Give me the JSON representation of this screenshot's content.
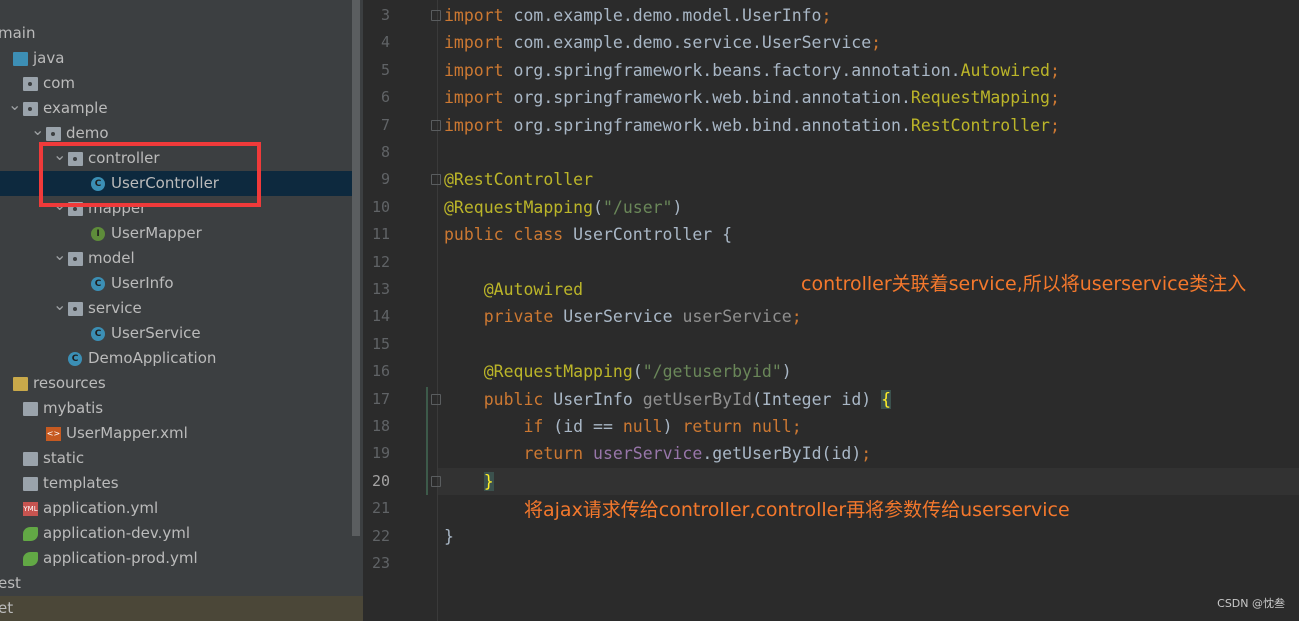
{
  "tree": [
    {
      "label": "main",
      "indent": -20,
      "icon": "none",
      "chev": ""
    },
    {
      "label": "java",
      "indent": -10,
      "icon": "src-folder",
      "chev": ""
    },
    {
      "label": "com",
      "indent": 10,
      "icon": "package",
      "chev": ""
    },
    {
      "label": "example",
      "indent": 10,
      "icon": "package",
      "chev": "v"
    },
    {
      "label": "demo",
      "indent": 33,
      "icon": "package",
      "chev": "v"
    },
    {
      "label": "controller",
      "indent": 55,
      "icon": "package",
      "chev": "v"
    },
    {
      "label": "UserController",
      "indent": 78,
      "icon": "class",
      "chev": "",
      "selected": true
    },
    {
      "label": "mapper",
      "indent": 55,
      "icon": "package",
      "chev": "v"
    },
    {
      "label": "UserMapper",
      "indent": 78,
      "icon": "interface",
      "chev": ""
    },
    {
      "label": "model",
      "indent": 55,
      "icon": "package",
      "chev": "v"
    },
    {
      "label": "UserInfo",
      "indent": 78,
      "icon": "class",
      "chev": ""
    },
    {
      "label": "service",
      "indent": 55,
      "icon": "package",
      "chev": "v"
    },
    {
      "label": "UserService",
      "indent": 78,
      "icon": "class",
      "chev": ""
    },
    {
      "label": "DemoApplication",
      "indent": 55,
      "icon": "spring-class",
      "chev": ""
    },
    {
      "label": "resources",
      "indent": -10,
      "icon": "resources-folder",
      "chev": ""
    },
    {
      "label": "mybatis",
      "indent": 10,
      "icon": "folder",
      "chev": ""
    },
    {
      "label": "UserMapper.xml",
      "indent": 33,
      "icon": "xml",
      "chev": ""
    },
    {
      "label": "static",
      "indent": 10,
      "icon": "folder",
      "chev": ""
    },
    {
      "label": "templates",
      "indent": 10,
      "icon": "folder",
      "chev": ""
    },
    {
      "label": "application.yml",
      "indent": 10,
      "icon": "yml",
      "chev": ""
    },
    {
      "label": "application-dev.yml",
      "indent": 10,
      "icon": "spring-yml",
      "chev": ""
    },
    {
      "label": "application-prod.yml",
      "indent": 10,
      "icon": "spring-yml",
      "chev": ""
    },
    {
      "label": "est",
      "indent": -20,
      "icon": "none",
      "chev": ""
    },
    {
      "label": "et",
      "indent": -20,
      "icon": "none",
      "chev": "",
      "bottom": true
    }
  ],
  "code": [
    {
      "n": "3",
      "tokens": [
        [
          "k",
          "import "
        ],
        [
          "p",
          "com.example.demo.model.UserInfo"
        ],
        [
          "k",
          ";"
        ]
      ],
      "fold": true
    },
    {
      "n": "4",
      "tokens": [
        [
          "k",
          "import "
        ],
        [
          "p",
          "com.example.demo.service.UserService"
        ],
        [
          "k",
          ";"
        ]
      ]
    },
    {
      "n": "5",
      "tokens": [
        [
          "k",
          "import "
        ],
        [
          "p",
          "org.springframework.beans.factory.annotation."
        ],
        [
          "a",
          "Autowired"
        ],
        [
          "k",
          ";"
        ]
      ]
    },
    {
      "n": "6",
      "tokens": [
        [
          "k",
          "import "
        ],
        [
          "p",
          "org.springframework.web.bind.annotation."
        ],
        [
          "a",
          "RequestMapping"
        ],
        [
          "k",
          ";"
        ]
      ]
    },
    {
      "n": "7",
      "tokens": [
        [
          "k",
          "import "
        ],
        [
          "p",
          "org.springframework.web.bind.annotation."
        ],
        [
          "a",
          "RestController"
        ],
        [
          "k",
          ";"
        ]
      ],
      "fold": true
    },
    {
      "n": "8",
      "tokens": []
    },
    {
      "n": "9",
      "tokens": [
        [
          "a",
          "@RestController"
        ]
      ],
      "fold": true
    },
    {
      "n": "10",
      "tokens": [
        [
          "a",
          "@RequestMapping"
        ],
        [
          "p",
          "("
        ],
        [
          "s",
          "\"/user\""
        ],
        [
          "p",
          ")"
        ]
      ]
    },
    {
      "n": "11",
      "tokens": [
        [
          "k",
          "public class "
        ],
        [
          "p",
          "UserController {"
        ]
      ]
    },
    {
      "n": "12",
      "tokens": []
    },
    {
      "n": "13",
      "tokens": [
        [
          "p",
          "    "
        ],
        [
          "a",
          "@Autowired"
        ]
      ]
    },
    {
      "n": "14",
      "tokens": [
        [
          "p",
          "    "
        ],
        [
          "k",
          "private "
        ],
        [
          "p",
          "UserService "
        ],
        [
          "g",
          "userService"
        ],
        [
          "k",
          ";"
        ]
      ]
    },
    {
      "n": "15",
      "tokens": []
    },
    {
      "n": "16",
      "tokens": [
        [
          "p",
          "    "
        ],
        [
          "a",
          "@RequestMapping"
        ],
        [
          "p",
          "("
        ],
        [
          "s",
          "\"/getuserbyid\""
        ],
        [
          "p",
          ")"
        ]
      ]
    },
    {
      "n": "17",
      "tokens": [
        [
          "p",
          "    "
        ],
        [
          "k",
          "public "
        ],
        [
          "p",
          "UserInfo "
        ],
        [
          "g",
          "getUserById"
        ],
        [
          "p",
          "(Integer id) "
        ],
        [
          "y",
          "{"
        ]
      ],
      "fold": true
    },
    {
      "n": "18",
      "tokens": [
        [
          "p",
          "        "
        ],
        [
          "k",
          "if "
        ],
        [
          "p",
          "(id == "
        ],
        [
          "k",
          "null"
        ],
        [
          "p",
          ") "
        ],
        [
          "k",
          "return null;"
        ]
      ]
    },
    {
      "n": "19",
      "tokens": [
        [
          "p",
          "        "
        ],
        [
          "k",
          "return "
        ],
        [
          "f",
          "userService"
        ],
        [
          "p",
          ".getUserById(id)"
        ],
        [
          "k",
          ";"
        ]
      ]
    },
    {
      "n": "20",
      "tokens": [
        [
          "p",
          "    "
        ],
        [
          "y",
          "}"
        ]
      ],
      "fold": true,
      "current": true
    },
    {
      "n": "21",
      "tokens": []
    },
    {
      "n": "22",
      "tokens": [
        [
          "p",
          "}"
        ]
      ]
    },
    {
      "n": "23",
      "tokens": []
    }
  ],
  "notes": {
    "service_note": "controller关联着service,所以将userservice类注入",
    "ajax_note": "将ajax请求传给controller,controller再将参数传给userservice"
  },
  "watermark": "CSDN @忱叁",
  "colors": {
    "keyword": "#cc7832",
    "annotation": "#bbb529",
    "string": "#6a8759",
    "field": "#9876aa",
    "note": "#f4782c",
    "highlight_box": "#f03a3a"
  }
}
